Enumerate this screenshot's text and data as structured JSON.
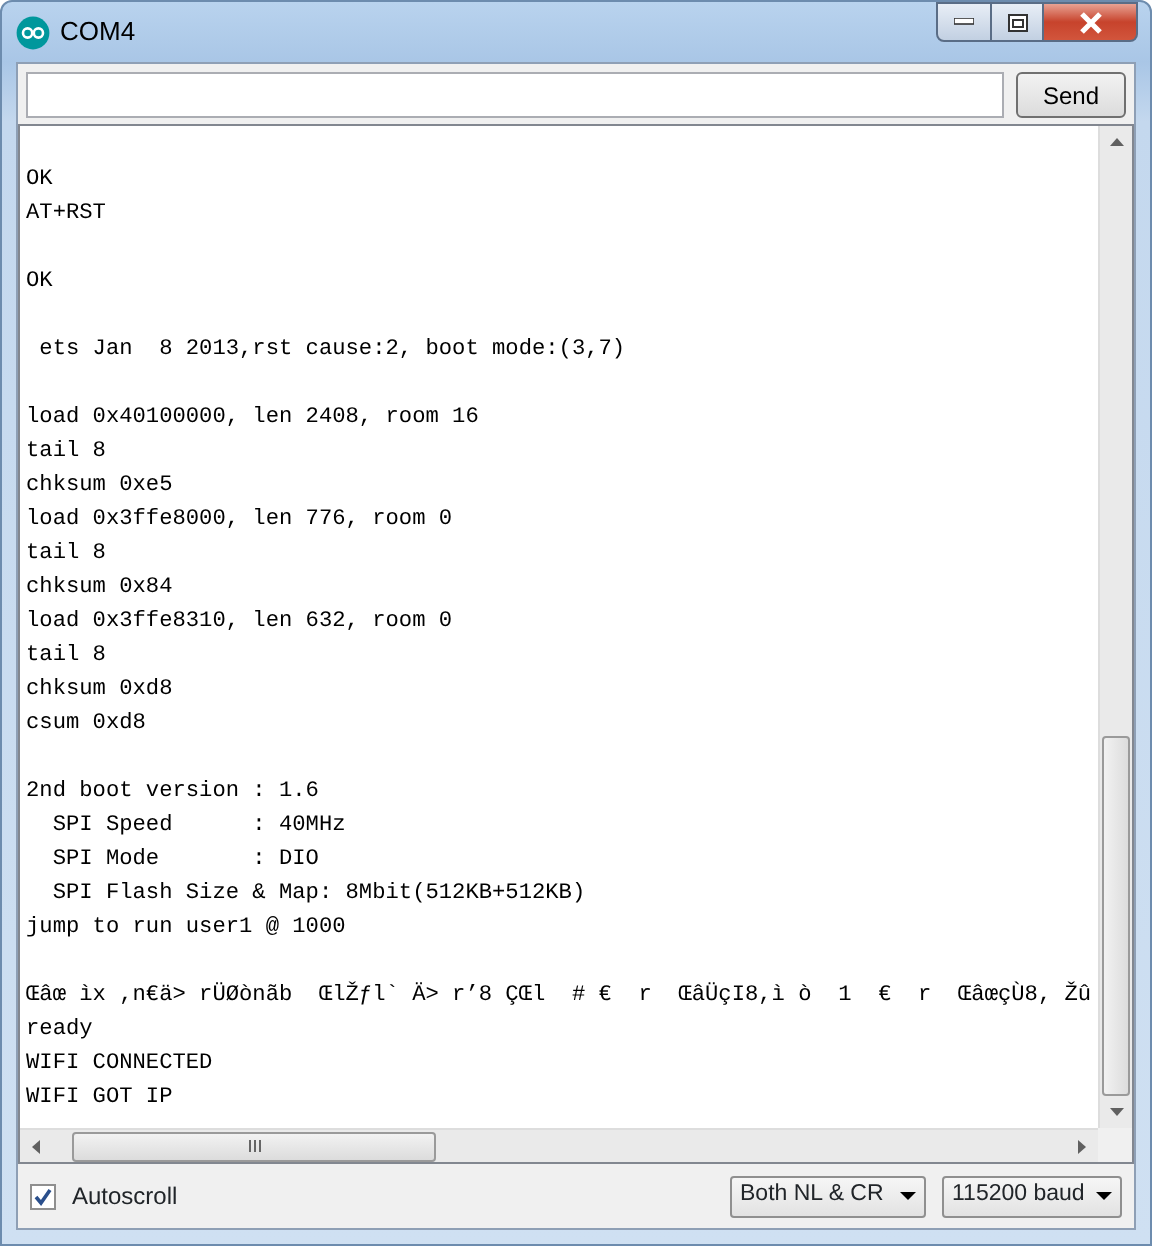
{
  "window": {
    "title": "COM4"
  },
  "send_bar": {
    "button": "Send"
  },
  "output": {
    "blocks": [
      [
        "OK",
        "AT+RST"
      ],
      [
        "OK"
      ],
      [
        " ets Jan  8 2013,rst cause:2, boot mode:(3,7)"
      ],
      [
        "load 0x40100000, len 2408, room 16",
        "tail 8",
        "chksum 0xe5",
        "load 0x3ffe8000, len 776, room 0",
        "tail 8",
        "chksum 0x84",
        "load 0x3ffe8310, len 632, room 0",
        "tail 8",
        "chksum 0xd8",
        "csum 0xd8"
      ],
      [
        "2nd boot version : 1.6",
        "  SPI Speed      : 40MHz",
        "  SPI Mode       : DIO",
        "  SPI Flash Size & Map: 8Mbit(512KB+512KB)",
        "jump to run user1 @ 1000"
      ],
      [
        "Œâœ ìx ,n€ä> rÜØònãb  ŒlŽƒl` Ä> r’8 ÇŒl  # €  r  ŒâÜçI8,ì ò  1  €  r  ŒâœçÙ8, Žû",
        "ready",
        "WIFI CONNECTED",
        "WIFI GOT IP"
      ]
    ]
  },
  "footer": {
    "autoscroll": {
      "label": "Autoscroll",
      "checked": true
    },
    "line_ending": "Both NL & CR",
    "baud": "115200 baud"
  }
}
